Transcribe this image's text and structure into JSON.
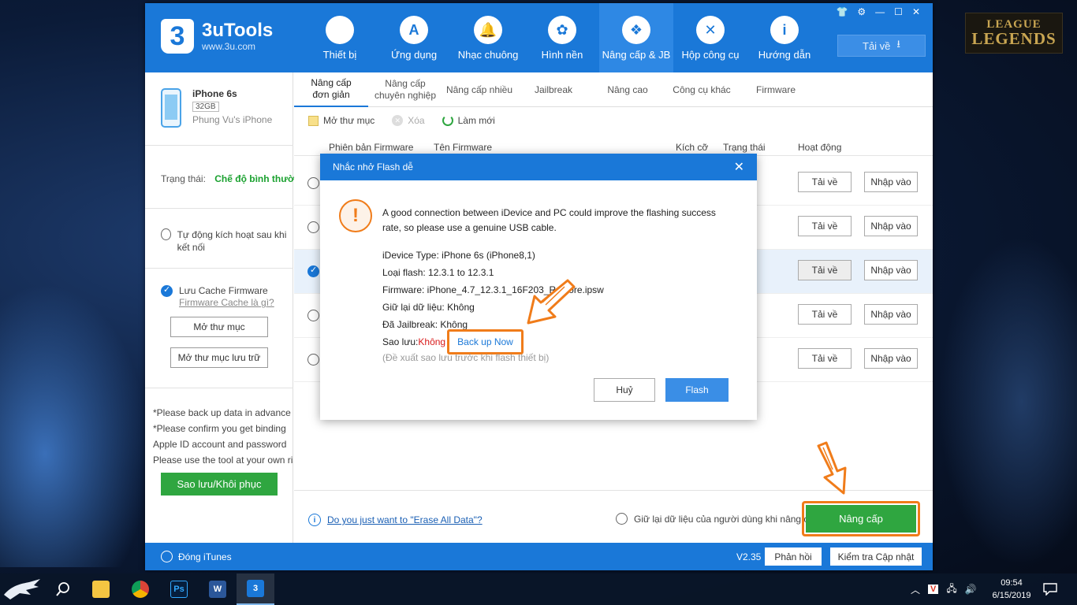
{
  "app": {
    "brand_name": "3uTools",
    "brand_url": "www.3u.com",
    "brand_logo": "3",
    "nav": [
      {
        "label": "Thiết bị",
        "icon": "apple-icon",
        "glyph": ""
      },
      {
        "label": "Ứng dụng",
        "icon": "app-store-icon",
        "glyph": "A"
      },
      {
        "label": "Nhạc chuông",
        "icon": "bell-icon",
        "glyph": "🔔"
      },
      {
        "label": "Hình nền",
        "icon": "flower-icon",
        "glyph": "✿"
      },
      {
        "label": "Nâng cấp & JB",
        "icon": "dropbox-icon",
        "glyph": "❖"
      },
      {
        "label": "Hộp công cụ",
        "icon": "tools-icon",
        "glyph": "✕"
      },
      {
        "label": "Hướng dẫn",
        "icon": "info-icon",
        "glyph": "i"
      }
    ],
    "download_label": "Tải về",
    "win_controls": [
      "👕",
      "⚙",
      "—",
      "☐",
      "✕"
    ]
  },
  "left": {
    "device_name": "iPhone 6s",
    "device_capacity": "32GB",
    "device_owner": "Phung Vu's iPhone",
    "status_label": "Trạng thái:",
    "status_value": "Chế độ bình thường",
    "auto_activate": "Tự động kích hoạt sau khi kết nối",
    "cache_label": "Lưu Cache Firmware",
    "cache_link": "Firmware Cache là gì?",
    "open_folder": "Mở thư mục",
    "open_storage": "Mở thư mục lưu trữ",
    "notes": [
      "*Please back up data in advance",
      "*Please confirm you get binding",
      "Apple ID account and password",
      "Please use the tool at your own risk"
    ],
    "backup_restore": "Sao lưu/Khôi phục"
  },
  "main": {
    "tabs": [
      "Nâng cấp\nđơn giản",
      "Nâng cấp\nchuyên nghiệp",
      "Nâng cấp nhiều",
      "Jailbreak",
      "Nâng cao",
      "Công cụ khác",
      "Firmware"
    ],
    "toolbar": {
      "open_folder": "Mở thư mục",
      "delete": "Xóa",
      "refresh": "Làm mới"
    },
    "columns": [
      "Phiên bản Firmware",
      "Tên Firmware",
      "Kích cỡ",
      "Trạng thái",
      "Hoạt động"
    ],
    "row_download": "Tải về",
    "row_import": "Nhập vào",
    "erase_link": "Do you just want to \"Erase All Data\"?",
    "keep_data": "Giữ lại dữ liệu của người dùng khi nâng cấp",
    "upgrade": "Nâng cấp"
  },
  "statusbar": {
    "itunes": "Đóng iTunes",
    "version": "V2.35",
    "feedback": "Phản hồi",
    "check_update": "Kiểm tra Cập nhật"
  },
  "modal": {
    "title": "Nhắc nhở Flash dễ",
    "message": "A good connection between iDevice and PC could improve the flashing success rate, so please use a genuine USB cable.",
    "device_type": "iDevice Type: iPhone 6s (iPhone8,1)",
    "flash_type": "Loại flash:  12.3.1  to 12.3.1",
    "firmware": "Firmware: iPhone_4.7_12.3.1_16F203_Restore.ipsw",
    "keep_data": "Giữ lại dữ liệu: Không",
    "jailbreak": "Đã Jailbreak: Không",
    "backup_label": "Sao lưu:",
    "backup_value": "Không",
    "backup_now": "Back up Now",
    "hint": "(Đề xuất sao lưu trước khi flash thiết bị)",
    "cancel": "Huỷ",
    "flash": "Flash"
  },
  "desktop": {
    "logo_line1": "LEAGUE",
    "logo_line2": "LEGENDS"
  },
  "taskbar": {
    "time": "09:54",
    "date": "6/15/2019"
  },
  "colors": {
    "brand_blue": "#1a78d8",
    "green": "#2fa640",
    "highlight_orange": "#f07c1a"
  }
}
